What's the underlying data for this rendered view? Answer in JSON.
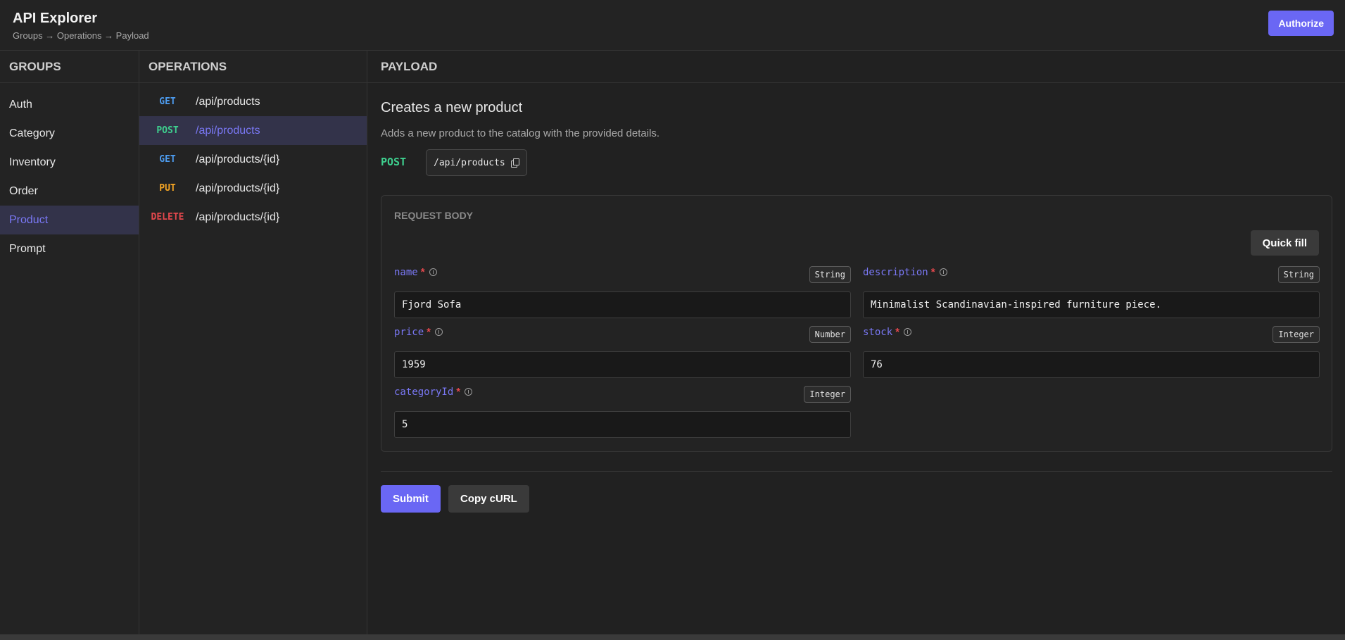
{
  "header": {
    "title": "API Explorer",
    "breadcrumb": "Groups → Operations → Payload",
    "authorize_label": "Authorize"
  },
  "colors": {
    "accent": "#6a67f4",
    "get": "#4d9cf0",
    "post": "#3ecf8e",
    "put": "#f5a524",
    "delete": "#e5484d",
    "required": "#e5484d"
  },
  "groups": {
    "title": "GROUPS",
    "items": [
      {
        "label": "Auth"
      },
      {
        "label": "Category"
      },
      {
        "label": "Inventory"
      },
      {
        "label": "Order"
      },
      {
        "label": "Product",
        "active": true
      },
      {
        "label": "Prompt"
      }
    ]
  },
  "operations": {
    "title": "OPERATIONS",
    "items": [
      {
        "method": "GET",
        "path": "/api/products"
      },
      {
        "method": "POST",
        "path": "/api/products",
        "active": true
      },
      {
        "method": "GET",
        "path": "/api/products/{id}"
      },
      {
        "method": "PUT",
        "path": "/api/products/{id}"
      },
      {
        "method": "DELETE",
        "path": "/api/products/{id}"
      }
    ]
  },
  "payload": {
    "title": "PAYLOAD",
    "op_title": "Creates a new product",
    "op_description": "Adds a new product to the catalog with the provided details.",
    "method": "POST",
    "path": "/api/products",
    "request_body": {
      "title": "REQUEST BODY",
      "quick_fill_label": "Quick fill",
      "fields": {
        "name": {
          "label": "name",
          "required": "*",
          "type": "String",
          "value": "Fjord Sofa"
        },
        "description": {
          "label": "description",
          "required": "*",
          "type": "String",
          "value": "Minimalist Scandinavian-inspired furniture piece."
        },
        "price": {
          "label": "price",
          "required": "*",
          "type": "Number",
          "value": "1959"
        },
        "stock": {
          "label": "stock",
          "required": "*",
          "type": "Integer",
          "value": "76"
        },
        "categoryId": {
          "label": "categoryId",
          "required": "*",
          "type": "Integer",
          "value": "5"
        }
      }
    },
    "submit_label": "Submit",
    "copy_curl_label": "Copy cURL"
  }
}
